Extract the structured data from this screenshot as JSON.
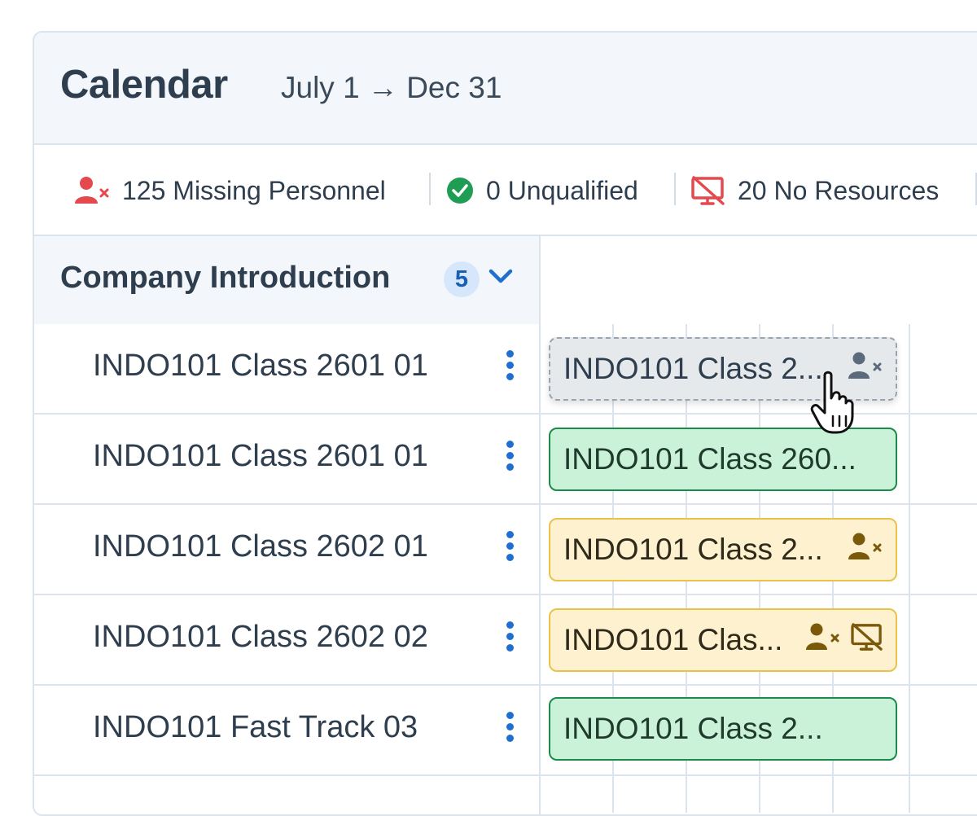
{
  "header": {
    "title": "Calendar",
    "date_range": "July 1 → Dec 31"
  },
  "status": {
    "missing_personnel": "125 Missing Personnel",
    "unqualified": "0 Unqualified",
    "no_resources": "20 No Resources"
  },
  "group": {
    "title": "Company Introduction",
    "count": "5"
  },
  "rows": [
    {
      "label": "INDO101 Class 2601 01",
      "bar": "INDO101 Class 2...",
      "bar_style": "dragging",
      "icons": [
        "missing-person-icon"
      ]
    },
    {
      "label": "INDO101 Class 2601 01",
      "bar": "INDO101 Class 260...",
      "bar_style": "ok",
      "icons": []
    },
    {
      "label": "INDO101 Class 2602 01",
      "bar": "INDO101 Class 2...",
      "bar_style": "warning",
      "icons": [
        "missing-person-icon"
      ]
    },
    {
      "label": "INDO101 Class 2602 02",
      "bar": "INDO101 Clas...",
      "bar_style": "warning",
      "icons": [
        "missing-person-icon",
        "no-resource-icon"
      ]
    },
    {
      "label": "INDO101 Fast Track 03",
      "bar": "INDO101 Class 2...",
      "bar_style": "ok",
      "icons": []
    }
  ],
  "colors": {
    "accent": "#1f6fd1",
    "danger": "#e5484d",
    "success": "#1f9d55",
    "warning_border": "#e8c24a",
    "ok_fill": "#c9f2d9"
  }
}
